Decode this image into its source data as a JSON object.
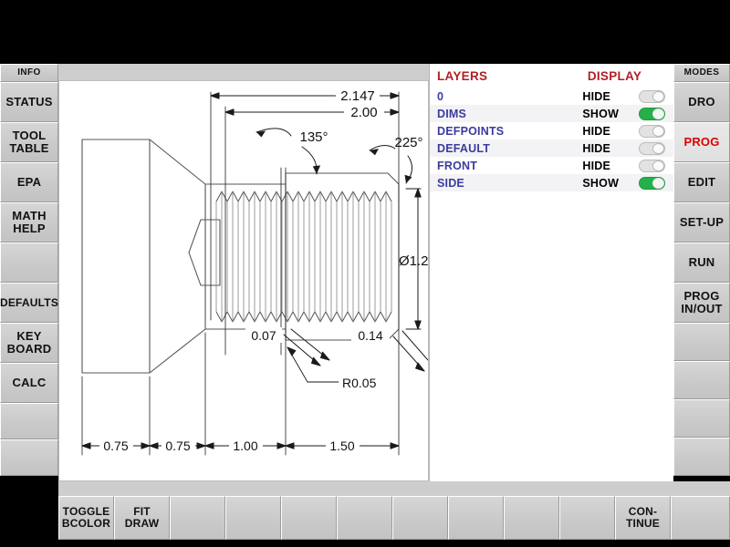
{
  "app": {
    "bg_color": "#cdcdcd",
    "accent_red": "#b12025",
    "layer_blue": "#3b3b9e",
    "toggle_on_color": "#25b04a",
    "toggle_off_color": "#e2e2e2"
  },
  "left_rail": {
    "header": "INFO",
    "items": [
      {
        "label": "STATUS",
        "active": false
      },
      {
        "label": "TOOL\nTABLE",
        "active": false
      },
      {
        "label": "EPA",
        "active": false
      },
      {
        "label": "MATH\nHELP",
        "active": false
      },
      {
        "label": "",
        "active": false
      },
      {
        "label": "DEFAULTS",
        "active": false
      },
      {
        "label": "KEY\nBOARD",
        "active": false
      },
      {
        "label": "CALC",
        "active": false
      },
      {
        "label": "",
        "active": false
      },
      {
        "label": "",
        "active": false
      }
    ]
  },
  "right_rail": {
    "header": "MODES",
    "items": [
      {
        "label": "DRO",
        "active": false
      },
      {
        "label": "PROG",
        "active": true
      },
      {
        "label": "EDIT",
        "active": false
      },
      {
        "label": "SET-UP",
        "active": false
      },
      {
        "label": "RUN",
        "active": false
      },
      {
        "label": "PROG\nIN/OUT",
        "active": false
      },
      {
        "label": "",
        "active": false
      },
      {
        "label": "",
        "active": false
      },
      {
        "label": "",
        "active": false
      },
      {
        "label": "",
        "active": false
      }
    ]
  },
  "layers": {
    "header_name": "LAYERS",
    "header_display": "DISPLAY",
    "rows": [
      {
        "name": "0",
        "state": "HIDE",
        "on": false
      },
      {
        "name": "DIMS",
        "state": "SHOW",
        "on": true
      },
      {
        "name": "DEFPOINTS",
        "state": "HIDE",
        "on": false
      },
      {
        "name": "DEFAULT",
        "state": "HIDE",
        "on": false
      },
      {
        "name": "FRONT",
        "state": "HIDE",
        "on": false
      },
      {
        "name": "SIDE",
        "state": "SHOW",
        "on": true
      }
    ]
  },
  "toolbar": {
    "buttons": [
      {
        "label": "TOGGLE\nBCOLOR"
      },
      {
        "label": "FIT\nDRAW"
      },
      {
        "label": ""
      },
      {
        "label": ""
      },
      {
        "label": ""
      },
      {
        "label": ""
      },
      {
        "label": ""
      },
      {
        "label": ""
      },
      {
        "label": ""
      },
      {
        "label": ""
      },
      {
        "label": "CON-\nTINUE"
      },
      {
        "label": ""
      }
    ]
  },
  "drawing": {
    "title": "turned-threaded-shaft-side-view",
    "dimensions": {
      "overall_upper": "2.147",
      "overall_lower": "2.00",
      "angle_left": "135°",
      "angle_right": "225°",
      "diameter": "Ø1.2",
      "chamfer_left": "0.07",
      "chamfer_right": "0.14",
      "radius": "R0.05",
      "baseline": [
        "0.75",
        "0.75",
        "1.00",
        "1.50"
      ]
    }
  }
}
